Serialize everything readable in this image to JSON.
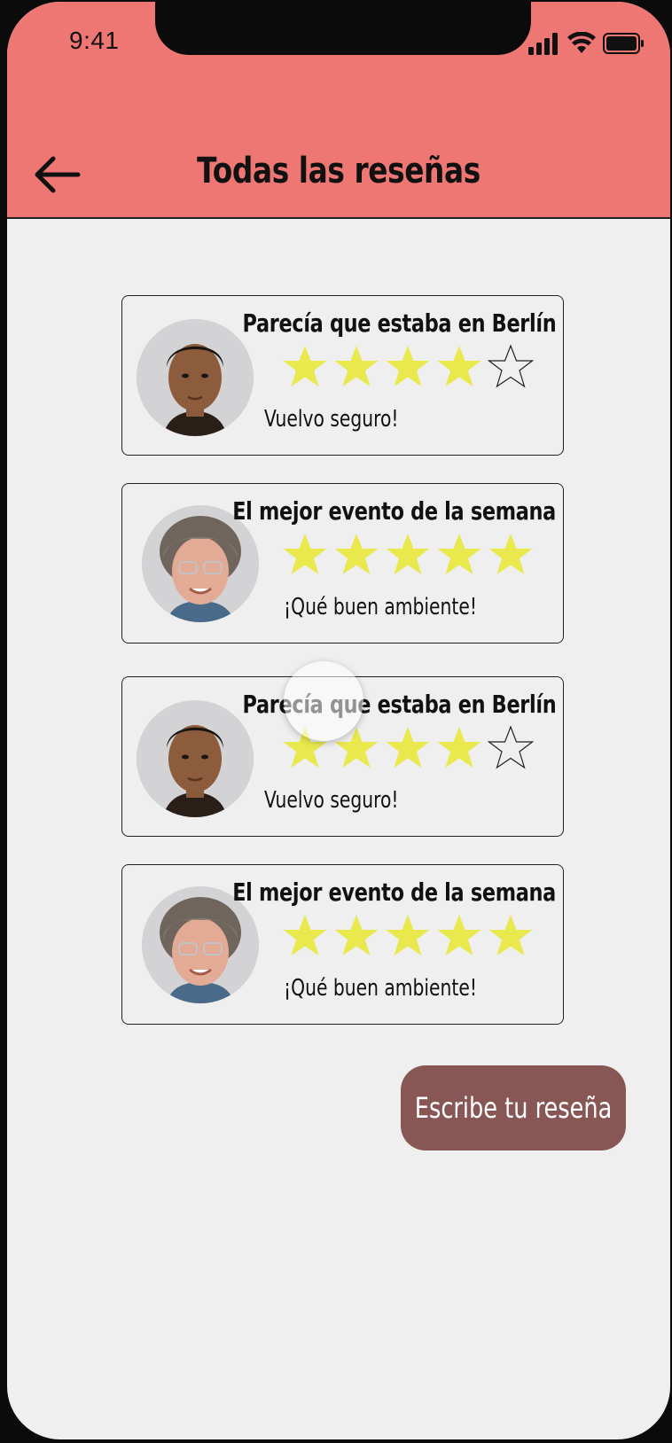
{
  "status_bar": {
    "time": "9:41"
  },
  "header": {
    "title": "Todas las reseñas",
    "back_icon": "arrow-left-icon"
  },
  "colors": {
    "header_bg": "#ef7773",
    "star_filled": "#e9e84d",
    "button_bg": "#885654",
    "page_bg": "#efefef"
  },
  "reviews": [
    {
      "title": "Parecía que estaba en Berlín",
      "rating": 4,
      "max_rating": 5,
      "text": "Vuelvo seguro!",
      "avatar": "young-man-avatar"
    },
    {
      "title": "El mejor evento de la semana",
      "rating": 5,
      "max_rating": 5,
      "text": "¡Qué buen ambiente!",
      "avatar": "older-woman-avatar"
    },
    {
      "title": "Parecía que estaba en Berlín",
      "rating": 4,
      "max_rating": 5,
      "text": "Vuelvo seguro!",
      "avatar": "young-man-avatar"
    },
    {
      "title": "El mejor evento de la semana",
      "rating": 5,
      "max_rating": 5,
      "text": "¡Qué buen ambiente!",
      "avatar": "older-woman-avatar"
    }
  ],
  "actions": {
    "write_review": "Escribe tu reseña"
  }
}
